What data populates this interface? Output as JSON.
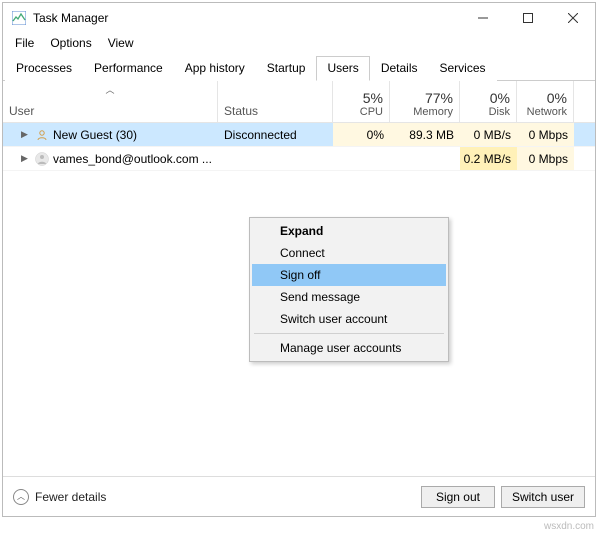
{
  "window": {
    "title": "Task Manager"
  },
  "menubar": {
    "file": "File",
    "options": "Options",
    "view": "View"
  },
  "tabs": [
    {
      "label": "Processes"
    },
    {
      "label": "Performance"
    },
    {
      "label": "App history"
    },
    {
      "label": "Startup"
    },
    {
      "label": "Users",
      "active": true
    },
    {
      "label": "Details"
    },
    {
      "label": "Services"
    }
  ],
  "columns": {
    "user": "User",
    "status": "Status",
    "cpu": {
      "pct": "5%",
      "label": "CPU"
    },
    "memory": {
      "pct": "77%",
      "label": "Memory"
    },
    "disk": {
      "pct": "0%",
      "label": "Disk"
    },
    "network": {
      "pct": "0%",
      "label": "Network"
    }
  },
  "rows": [
    {
      "name": "New Guest (30)",
      "status": "Disconnected",
      "cpu": "0%",
      "memory": "89.3 MB",
      "disk": "0 MB/s",
      "network": "0 Mbps",
      "selected": true
    },
    {
      "name": "vames_bond@outlook.com ...",
      "status": "",
      "cpu": "",
      "memory": "",
      "disk": "0.2 MB/s",
      "network": "0 Mbps",
      "selected": false
    }
  ],
  "context_menu": {
    "items": [
      {
        "label": "Expand",
        "bold": true
      },
      {
        "label": "Connect"
      },
      {
        "label": "Sign off",
        "highlight": true
      },
      {
        "label": "Send message"
      },
      {
        "label": "Switch user account"
      }
    ],
    "divider_then": {
      "label": "Manage user accounts"
    }
  },
  "footer": {
    "fewer": "Fewer details",
    "sign_out": "Sign out",
    "switch_user": "Switch user"
  },
  "watermark": "wsxdn.com"
}
